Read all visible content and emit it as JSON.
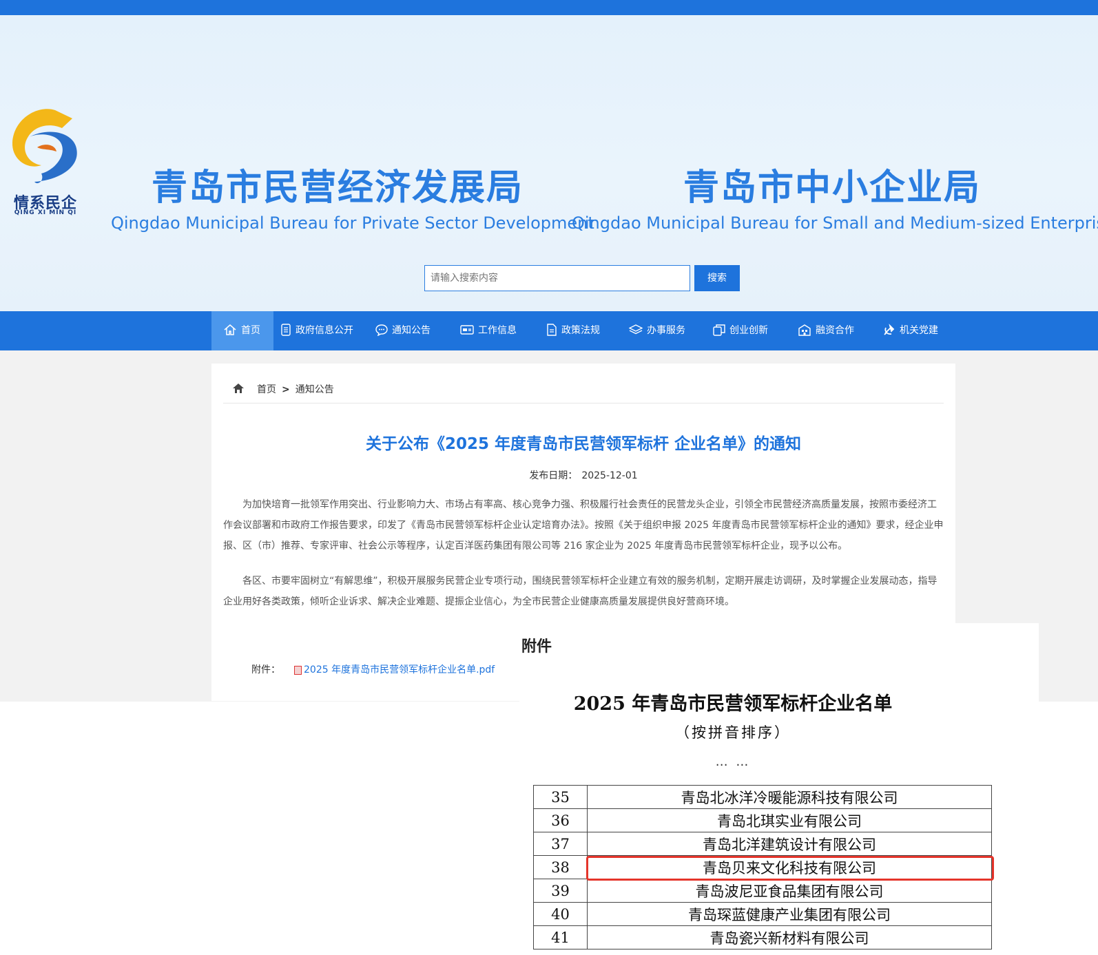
{
  "header": {
    "logo": {
      "text": "情系民企",
      "subtext": "QING XI MIN QI"
    },
    "bureau1": {
      "cn": "青岛市民营经济发展局",
      "en": "Qingdao Municipal Bureau for Private Sector Development"
    },
    "bureau2": {
      "cn": "青岛市中小企业局",
      "en": "Qingdao Municipal Bureau for Small and Medium-sized Enterprises"
    },
    "search": {
      "placeholder": "请输入搜索内容",
      "button": "搜索"
    },
    "brand_color": "#1e73dc"
  },
  "nav": {
    "items": [
      {
        "label": "首页",
        "icon": "home-icon",
        "active": true
      },
      {
        "label": "政府信息公开",
        "icon": "document-icon"
      },
      {
        "label": "通知公告",
        "icon": "chat-icon"
      },
      {
        "label": "工作信息",
        "icon": "monitor-icon"
      },
      {
        "label": "政策法规",
        "icon": "file-icon"
      },
      {
        "label": "办事服务",
        "icon": "layers-icon"
      },
      {
        "label": "创业创新",
        "icon": "copy-icon"
      },
      {
        "label": "融资合作",
        "icon": "building-icon"
      },
      {
        "label": "机关党建",
        "icon": "party-icon"
      }
    ]
  },
  "breadcrumb": {
    "home": "首页",
    "sep": ">",
    "current": "通知公告"
  },
  "article": {
    "title": "关于公布《2025 年度青岛市民营领军标杆 企业名单》的通知",
    "date_label": "发布日期：",
    "date": "2025-12-01",
    "paragraphs": [
      "为加快培育一批领军作用突出、行业影响力大、市场占有率高、核心竞争力强、积极履行社会责任的民营龙头企业，引领全市民营经济高质量发展，按照市委经济工作会议部署和市政府工作报告要求，印发了《青岛市民营领军标杆企业认定培育办法》。按照《关于组织申报 2025 年度青岛市民营领军标杆企业的通知》要求，经企业申报、区（市）推荐、专家评审、社会公示等程序，认定百洋医药集团有限公司等 216 家企业为 2025 年度青岛市民营领军标杆企业，现予以公布。",
      "各区、市要牢固树立“有解思维”，积极开展服务民营企业专项行动，围绕民营领军标杆企业建立有效的服务机制，定期开展走访调研，及时掌握企业发展动态，指导企业用好各类政策，倾听企业诉求、解决企业难题、提振企业信心，为全市民营企业健康高质量发展提供良好营商环境。"
    ],
    "attachment_heading": "附件",
    "attachment_label": "附件：",
    "attachment_file": "2025 年度青岛市民营领军标杆企业名单.pdf"
  },
  "document": {
    "title": "2025 年青岛市民营领军标杆企业名单",
    "subtitle": "（按拼音排序）",
    "ellipsis": "… …",
    "rows": [
      {
        "num": "35",
        "name": "青岛北冰洋冷暖能源科技有限公司"
      },
      {
        "num": "36",
        "name": "青岛北琪实业有限公司"
      },
      {
        "num": "37",
        "name": "青岛北洋建筑设计有限公司"
      },
      {
        "num": "38",
        "name": "青岛贝来文化科技有限公司",
        "highlighted": true
      },
      {
        "num": "39",
        "name": "青岛波尼亚食品集团有限公司"
      },
      {
        "num": "40",
        "name": "青岛琛蓝健康产业集团有限公司"
      },
      {
        "num": "41",
        "name": "青岛瓷兴新材料有限公司"
      }
    ],
    "highlight_color": "#e5352b"
  }
}
